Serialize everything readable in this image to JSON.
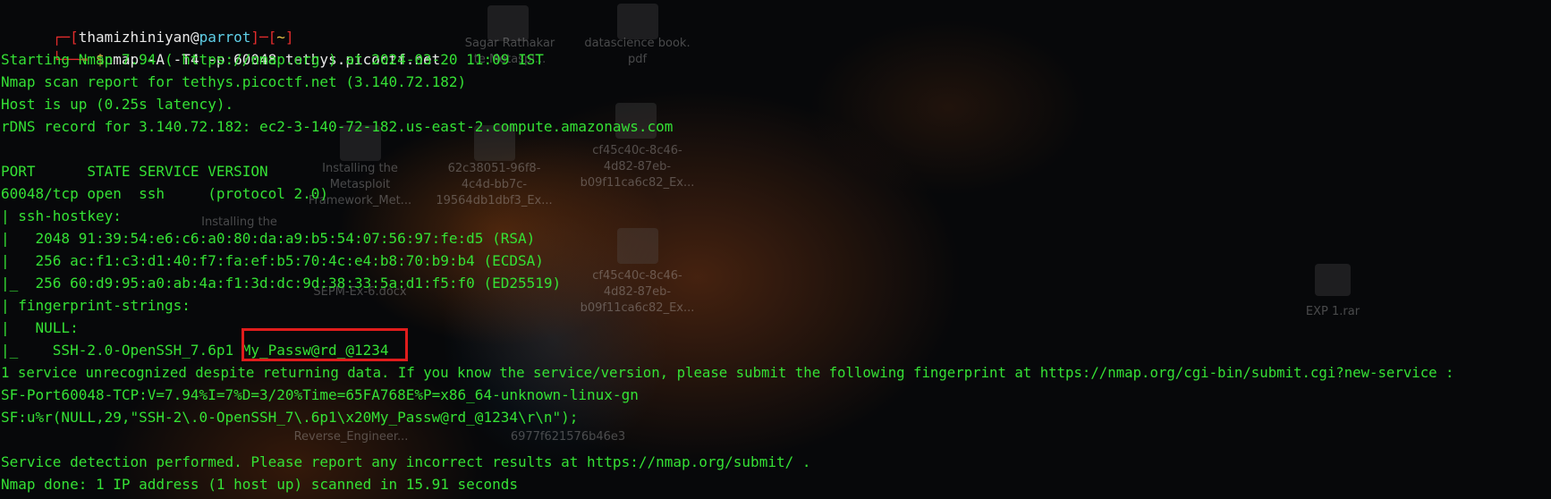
{
  "desktop": {
    "icons": [
      {
        "label": "Sagar Rathakar\nte Metaspl..."
      },
      {
        "label": "datascience book.\npdf"
      },
      {
        "label": "Installing the\nMetasploit\nFramework_Met..."
      },
      {
        "label": "62c38051-96f8-\n4c4d-bb7c-\n19564db1dbf3_Ex..."
      },
      {
        "label": "cf45c40c-8c46-\n4d82-87eb-\nb09f11ca6c82_Ex..."
      },
      {
        "label": "Installing the"
      },
      {
        "label": "cf45c40c-8c46-\n4d82-87eb-\nb09f11ca6c82_Ex..."
      },
      {
        "label": "SEPM-Ex-6.docx"
      },
      {
        "label": "EXP 1.rar"
      },
      {
        "label": "Reverse_Engineer..."
      },
      {
        "label": "6977f621576b46e3"
      }
    ]
  },
  "terminal": {
    "prompt": {
      "bracket_open": "┌─[",
      "user": "thamizhiniyan",
      "at": "@",
      "host": "parrot",
      "mid": "]─[",
      "dir": "~",
      "bracket_close": "]",
      "second_prefix": "└──╼ ",
      "dollar": "$",
      "command": "nmap -A -T4 -p 60048 tethys.picoctf.net"
    },
    "output": [
      "Starting Nmap 7.94 ( https://nmap.org ) at 2024-03-20 11:09 IST",
      "Nmap scan report for tethys.picoctf.net (3.140.72.182)",
      "Host is up (0.25s latency).",
      "rDNS record for 3.140.72.182: ec2-3-140-72-182.us-east-2.compute.amazonaws.com",
      "",
      "PORT      STATE SERVICE VERSION",
      "60048/tcp open  ssh     (protocol 2.0)",
      "| ssh-hostkey: ",
      "|   2048 91:39:54:e6:c6:a0:80:da:a9:b5:54:07:56:97:fe:d5 (RSA)",
      "|   256 ac:f1:c3:d1:40:f7:fa:ef:b5:70:4c:e4:b8:70:b9:b4 (ECDSA)",
      "|_  256 60:d9:95:a0:ab:4a:f1:3d:dc:9d:38:33:5a:d1:f5:f0 (ED25519)",
      "| fingerprint-strings: ",
      "|   NULL: ",
      "|_    SSH-2.0-OpenSSH_7.6p1 My_Passw@rd_@1234",
      "1 service unrecognized despite returning data. If you know the service/version, please submit the following fingerprint at https://nmap.org/cgi-bin/submit.cgi?new-service :",
      "SF-Port60048-TCP:V=7.94%I=7%D=3/20%Time=65FA768E%P=x86_64-unknown-linux-gn",
      "SF:u%r(NULL,29,\"SSH-2\\.0-OpenSSH_7\\.6p1\\x20My_Passw@rd_@1234\\r\\n\");",
      "",
      "Service detection performed. Please report any incorrect results at https://nmap.org/submit/ .",
      "Nmap done: 1 IP address (1 host up) scanned in 15.91 seconds"
    ],
    "highlight_color": "#e01c1c",
    "text_color": "#35e135"
  }
}
